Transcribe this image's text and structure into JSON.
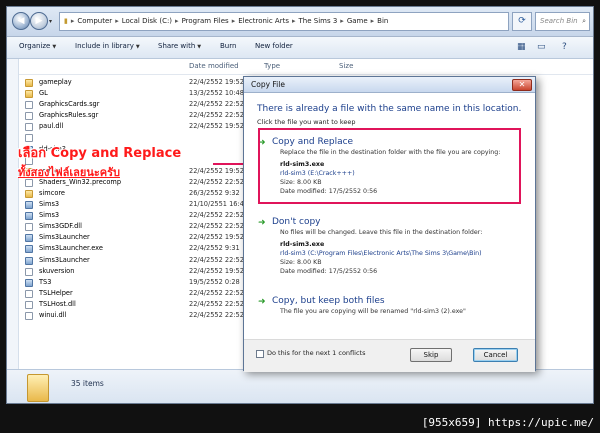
{
  "explorer": {
    "address": {
      "crumbs": [
        "Computer",
        "Local Disk (C:)",
        "Program Files",
        "Electronic Arts",
        "The Sims 3",
        "Game",
        "Bin"
      ],
      "search_placeholder": "Search Bin"
    },
    "toolbar": {
      "organize": "Organize",
      "include_in_library": "Include in library",
      "share_with": "Share with",
      "burn": "Burn",
      "new_folder": "New folder"
    },
    "columns": {
      "date_modified": "Date modified",
      "type": "Type",
      "size": "Size"
    },
    "files": [
      {
        "name": "gameplay",
        "date": "22/4/2552 19:52",
        "kind": "folder"
      },
      {
        "name": "GL",
        "date": "13/3/2552 10:48",
        "kind": "folder"
      },
      {
        "name": "GraphicsCards.sgr",
        "date": "22/4/2552 22:52",
        "kind": "file"
      },
      {
        "name": "GraphicsRules.sgr",
        "date": "22/4/2552 22:52",
        "kind": "file"
      },
      {
        "name": "paul.dll",
        "date": "22/4/2552 19:52",
        "kind": "file"
      },
      {
        "name": "",
        "date": "",
        "kind": "file"
      },
      {
        "name": "rld-sim3",
        "date": "",
        "kind": "app"
      },
      {
        "name": "",
        "date": "",
        "kind": "file"
      },
      {
        "name": "scripts",
        "date": "22/4/2552 19:52",
        "kind": "folder"
      },
      {
        "name": "Shaders_Win32.precomp",
        "date": "22/4/2552 22:52",
        "kind": "file"
      },
      {
        "name": "simcore",
        "date": "26/3/2552 9:32",
        "kind": "folder"
      },
      {
        "name": "Sims3",
        "date": "21/10/2551 16:48",
        "kind": "app"
      },
      {
        "name": "Sims3",
        "date": "22/4/2552 22:52",
        "kind": "app"
      },
      {
        "name": "Sims3GDF.dll",
        "date": "22/4/2552 22:52",
        "kind": "file"
      },
      {
        "name": "Sims3Launcher",
        "date": "22/4/2552 19:52",
        "kind": "app"
      },
      {
        "name": "Sims3Launcher.exe",
        "date": "22/4/2552 9:31",
        "kind": "app"
      },
      {
        "name": "Sims3Launcher",
        "date": "22/4/2552 22:52",
        "kind": "app"
      },
      {
        "name": "skuversion",
        "date": "22/4/2552 19:52",
        "kind": "file"
      },
      {
        "name": "TS3",
        "date": "19/5/2552 0:28",
        "kind": "app"
      },
      {
        "name": "TSLHelper",
        "date": "22/4/2552 22:52",
        "kind": "file"
      },
      {
        "name": "TSLHost.dll",
        "date": "22/4/2552 22:52",
        "kind": "file"
      },
      {
        "name": "winui.dll",
        "date": "22/4/2552 22:52",
        "kind": "file"
      }
    ],
    "status": {
      "count": "35 items"
    }
  },
  "overlay": {
    "line1": "เลือก Copy and Replace",
    "line2": "ทั้งสองไฟล์เลยนะครับ"
  },
  "dialog": {
    "title": "Copy File",
    "heading": "There is already a file with the same name in this location.",
    "subheading": "Click the file you want to keep",
    "option1": {
      "title": "Copy and Replace",
      "desc": "Replace the file in the destination folder with the file you are copying:",
      "filename": "rld-sim3.exe",
      "path": "rld-sim3 (E:\\Crack+++)",
      "size": "Size: 8.00 KB",
      "date": "Date modified: 17/5/2552 0:56"
    },
    "option2": {
      "title": "Don't copy",
      "desc": "No files will be changed. Leave this file in the destination folder:",
      "filename": "rld-sim3.exe",
      "path": "rld-sim3 (C:\\Program Files\\Electronic Arts\\The Sims 3\\Game\\Bin)",
      "size": "Size: 8.00 KB",
      "date": "Date modified: 17/5/2552 0:56"
    },
    "option3": {
      "title": "Copy, but keep both files",
      "desc": "The file you are copying will be renamed \"rld-sim3 (2).exe\""
    },
    "footer": {
      "checkbox_label": "Do this for the next 1 conflicts",
      "skip": "Skip",
      "cancel": "Cancel"
    }
  },
  "watermark": "[955x659] https://upic.me/",
  "colors": {
    "highlight": "#e0145a",
    "overlay_text": "#ff1a1a",
    "link_blue": "#1c3f8c"
  }
}
